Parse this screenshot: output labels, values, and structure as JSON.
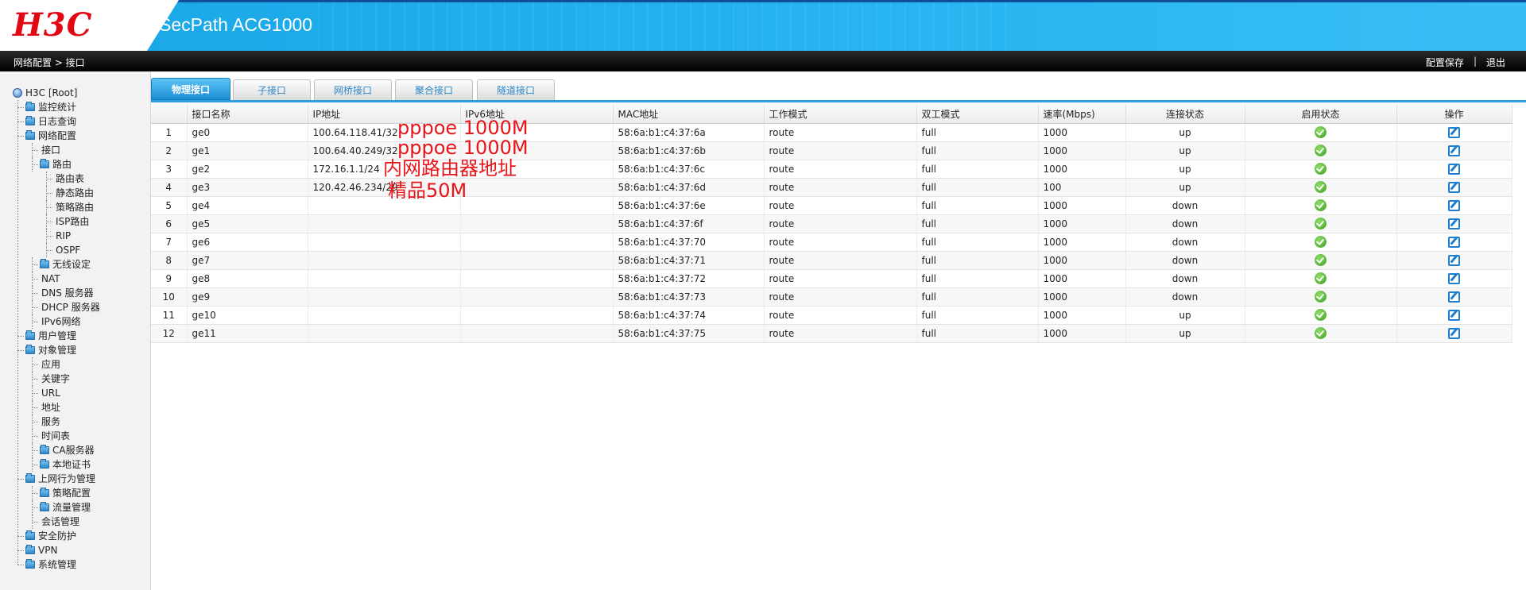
{
  "header": {
    "logo": "H3C",
    "product": "SecPath ACG1000"
  },
  "navbar": {
    "breadcrumb": "网络配置 > 接口",
    "save_label": "配置保存",
    "separator": "|",
    "logout_label": "退出"
  },
  "sidebar": {
    "root": "H3C [Root]",
    "items": [
      {
        "label": "监控统计",
        "level": 1,
        "folder": true
      },
      {
        "label": "日志查询",
        "level": 1,
        "folder": true
      },
      {
        "label": "网络配置",
        "level": 1,
        "folder": true
      },
      {
        "label": "接口",
        "level": 2,
        "folder": false
      },
      {
        "label": "路由",
        "level": 2,
        "folder": true
      },
      {
        "label": "路由表",
        "level": 3,
        "folder": false
      },
      {
        "label": "静态路由",
        "level": 3,
        "folder": false
      },
      {
        "label": "策略路由",
        "level": 3,
        "folder": false
      },
      {
        "label": "ISP路由",
        "level": 3,
        "folder": false
      },
      {
        "label": "RIP",
        "level": 3,
        "folder": false
      },
      {
        "label": "OSPF",
        "level": 3,
        "folder": false
      },
      {
        "label": "无线设定",
        "level": 2,
        "folder": true
      },
      {
        "label": "NAT",
        "level": 2,
        "folder": false
      },
      {
        "label": "DNS 服务器",
        "level": 2,
        "folder": false
      },
      {
        "label": "DHCP 服务器",
        "level": 2,
        "folder": false
      },
      {
        "label": "IPv6网络",
        "level": 2,
        "folder": false
      },
      {
        "label": "用户管理",
        "level": 1,
        "folder": true
      },
      {
        "label": "对象管理",
        "level": 1,
        "folder": true
      },
      {
        "label": "应用",
        "level": 2,
        "folder": false
      },
      {
        "label": "关键字",
        "level": 2,
        "folder": false
      },
      {
        "label": "URL",
        "level": 2,
        "folder": false
      },
      {
        "label": "地址",
        "level": 2,
        "folder": false
      },
      {
        "label": "服务",
        "level": 2,
        "folder": false
      },
      {
        "label": "时间表",
        "level": 2,
        "folder": false
      },
      {
        "label": "CA服务器",
        "level": 2,
        "folder": true
      },
      {
        "label": "本地证书",
        "level": 2,
        "folder": true
      },
      {
        "label": "上网行为管理",
        "level": 1,
        "folder": true
      },
      {
        "label": "策略配置",
        "level": 2,
        "folder": true
      },
      {
        "label": "流量管理",
        "level": 2,
        "folder": true
      },
      {
        "label": "会话管理",
        "level": 2,
        "folder": false
      },
      {
        "label": "安全防护",
        "level": 1,
        "folder": true
      },
      {
        "label": "VPN",
        "level": 1,
        "folder": true
      },
      {
        "label": "系统管理",
        "level": 1,
        "folder": true
      }
    ]
  },
  "tabs": [
    "物理接口",
    "子接口",
    "网桥接口",
    "聚合接口",
    "隧道接口"
  ],
  "table": {
    "headers": [
      "",
      "接口名称",
      "IP地址",
      "IPv6地址",
      "MAC地址",
      "工作模式",
      "双工模式",
      "速率(Mbps)",
      "连接状态",
      "启用状态",
      "操作"
    ],
    "rows": [
      [
        "1",
        "ge0",
        "100.64.118.41/32",
        "",
        "58:6a:b1:c4:37:6a",
        "route",
        "full",
        "1000",
        "up"
      ],
      [
        "2",
        "ge1",
        "100.64.40.249/32",
        "",
        "58:6a:b1:c4:37:6b",
        "route",
        "full",
        "1000",
        "up"
      ],
      [
        "3",
        "ge2",
        "172.16.1.1/24",
        "",
        "58:6a:b1:c4:37:6c",
        "route",
        "full",
        "1000",
        "up"
      ],
      [
        "4",
        "ge3",
        "120.42.46.234/29",
        "",
        "58:6a:b1:c4:37:6d",
        "route",
        "full",
        "100",
        "up"
      ],
      [
        "5",
        "ge4",
        "",
        "",
        "58:6a:b1:c4:37:6e",
        "route",
        "full",
        "1000",
        "down"
      ],
      [
        "6",
        "ge5",
        "",
        "",
        "58:6a:b1:c4:37:6f",
        "route",
        "full",
        "1000",
        "down"
      ],
      [
        "7",
        "ge6",
        "",
        "",
        "58:6a:b1:c4:37:70",
        "route",
        "full",
        "1000",
        "down"
      ],
      [
        "8",
        "ge7",
        "",
        "",
        "58:6a:b1:c4:37:71",
        "route",
        "full",
        "1000",
        "down"
      ],
      [
        "9",
        "ge8",
        "",
        "",
        "58:6a:b1:c4:37:72",
        "route",
        "full",
        "1000",
        "down"
      ],
      [
        "10",
        "ge9",
        "",
        "",
        "58:6a:b1:c4:37:73",
        "route",
        "full",
        "1000",
        "down"
      ],
      [
        "11",
        "ge10",
        "",
        "",
        "58:6a:b1:c4:37:74",
        "route",
        "full",
        "1000",
        "up"
      ],
      [
        "12",
        "ge11",
        "",
        "",
        "58:6a:b1:c4:37:75",
        "route",
        "full",
        "1000",
        "up"
      ]
    ],
    "enabled_icon": "check-circle-icon",
    "action_icon": "edit-icon"
  },
  "annotations": [
    "pppoe 1000M",
    "pppoe 1000M",
    "内网路由器地址",
    "精品50M"
  ],
  "colors": {
    "header_blue": "#22b0ee",
    "logo_red": "#e30613",
    "tab_active": "#1d8fd6",
    "annotation_red": "#e8141a"
  }
}
